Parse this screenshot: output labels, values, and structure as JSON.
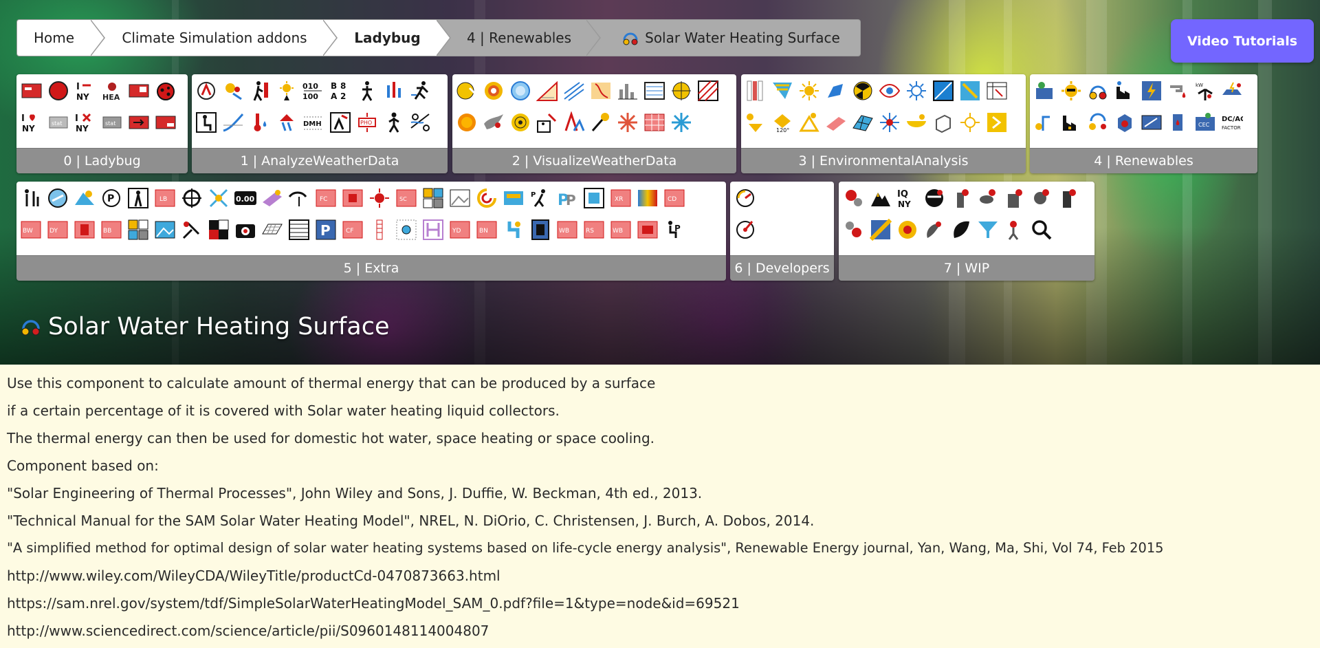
{
  "breadcrumb": {
    "home": "Home",
    "addons": "Climate Simulation addons",
    "plugin": "Ladybug",
    "category": "4 | Renewables",
    "component": "Solar Water Heating Surface",
    "component_icon": "solar-water-heating-icon"
  },
  "video_button": {
    "label": "Video Tutorials",
    "color": "#7366ff"
  },
  "toolbox": {
    "panels": [
      {
        "label": "0 | Ladybug"
      },
      {
        "label": "1 | AnalyzeWeatherData"
      },
      {
        "label": "2 | VisualizeWeatherData"
      },
      {
        "label": "3 | EnvironmentalAnalysis"
      },
      {
        "label": "4 | Renewables"
      },
      {
        "label": "5 | Extra"
      },
      {
        "label": "6 | Developers"
      },
      {
        "label": "7 | WIP"
      }
    ]
  },
  "page_title": "Solar Water Heating Surface",
  "description": [
    "Use this component to calculate amount of thermal energy that can be produced by a surface",
    "if a certain percentage of it is covered with Solar water heating liquid collectors.",
    "The thermal energy can then be used for domestic hot water, space heating or space cooling.",
    "Component based on:",
    "\"Solar Engineering of Thermal Processes\", John Wiley and Sons, J. Duffie, W. Beckman, 4th ed., 2013.",
    "\"Technical Manual for the SAM Solar Water Heating Model\", NREL, N. DiOrio, C. Christensen, J. Burch, A. Dobos, 2014.",
    "\"A simplified method for optimal design of solar water heating systems based on life-cycle energy analysis\", Renewable Energy journal, Yan, Wang, Ma, Shi, Vol 74, Feb 2015",
    "http://www.wiley.com/WileyCDA/WileyTitle/productCd-0470873663.html",
    "https://sam.nrel.gov/system/tdf/SimpleSolarWaterHeatingModel_SAM_0.pdf?file=1&type=node&id=69521",
    "http://www.sciencedirect.com/science/article/pii/S0960148114004807"
  ],
  "colors": {
    "description_background": "#fefbe3",
    "panel_label_background": "#8f8f8f"
  }
}
